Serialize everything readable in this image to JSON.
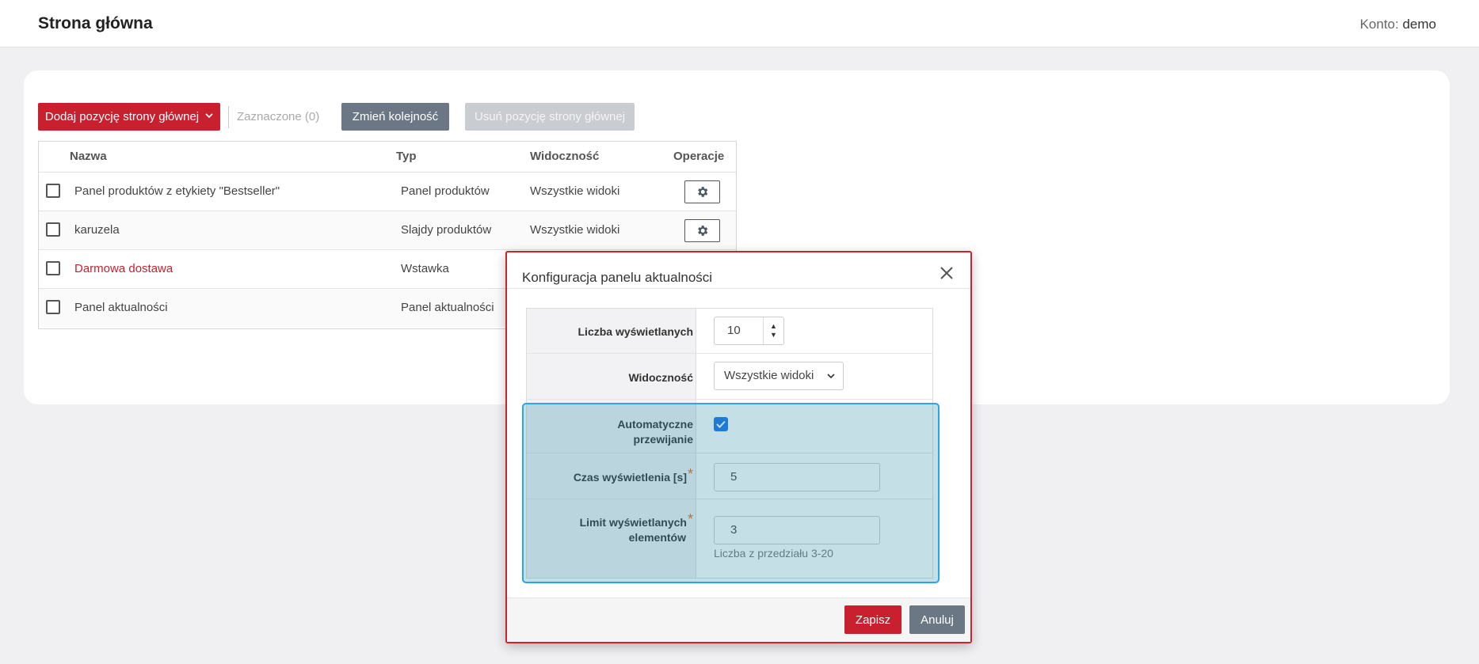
{
  "header": {
    "title": "Strona główna",
    "account_label": "Konto:",
    "account_user": "demo"
  },
  "toolbar": {
    "add_label": "Dodaj pozycję strony głównej",
    "selected_label": "Zaznaczone (0)",
    "reorder_label": "Zmień kolejność",
    "delete_label": "Usuń pozycję strony głównej"
  },
  "table": {
    "columns": [
      "Nazwa",
      "Typ",
      "Widoczność",
      "Operacje"
    ],
    "rows": [
      {
        "name": "Panel produktów z etykiety \"Bestseller\"",
        "type": "Panel produktów",
        "visibility": "Wszystkie widoki"
      },
      {
        "name": "karuzela",
        "type": "Slajdy produktów",
        "visibility": "Wszystkie widoki"
      },
      {
        "name": "Darmowa dostawa",
        "type": "Wstawka",
        "visibility": ""
      },
      {
        "name": "Panel aktualności",
        "type": "Panel aktualności",
        "visibility": ""
      }
    ]
  },
  "modal": {
    "title": "Konfiguracja panelu aktualności",
    "fields": {
      "count_label": "Liczba wyświetlanych",
      "count_value": "10",
      "visibility_label": "Widoczność",
      "visibility_value": "Wszystkie widoki",
      "autoscroll_label_line1": "Automatyczne",
      "autoscroll_label_line2": "przewijanie",
      "autoscroll_checked": true,
      "time_label": "Czas wyświetlenia [s]",
      "time_value": "5",
      "limit_label_line1": "Limit wyświetlanych",
      "limit_label_line2": "elementów",
      "limit_value": "3",
      "limit_hint": "Liczba z przedziału 3-20",
      "required_mark": "*"
    },
    "save_label": "Zapisz",
    "cancel_label": "Anuluj"
  },
  "colors": {
    "primary_red": "#c8202f",
    "secondary_gray": "#6b7785",
    "disabled_gray": "#c9cdd2",
    "highlight_blue": "#27a9df",
    "checkbox_blue": "#1a73e8"
  }
}
